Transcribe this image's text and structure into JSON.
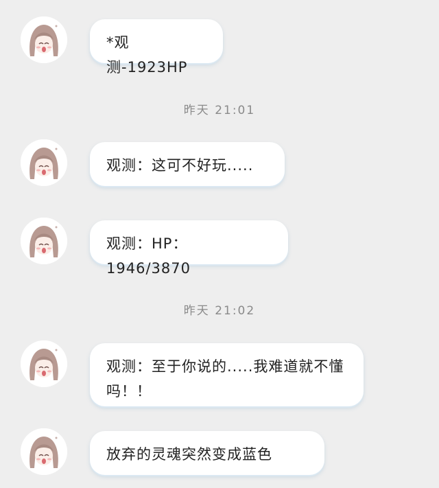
{
  "messages": [
    {
      "text": "*观测-1923HP"
    },
    {
      "text": "观测：这可不好玩....."
    },
    {
      "text": "观测：HP：1946/3870"
    },
    {
      "text": "观测：至于你说的.....我难道就不懂吗！！"
    },
    {
      "text": "放弃的灵魂突然变成蓝色"
    }
  ],
  "timestamps": [
    {
      "text": "昨天 21:01"
    },
    {
      "text": "昨天 21:02"
    }
  ],
  "colors": {
    "background": "#eeeeee",
    "bubble": "#ffffff",
    "bubble_shadow": "#dbe8f2",
    "timestamp_text": "#8a8a8a"
  },
  "icons": {
    "avatar": "anime-girl-avatar-icon"
  }
}
